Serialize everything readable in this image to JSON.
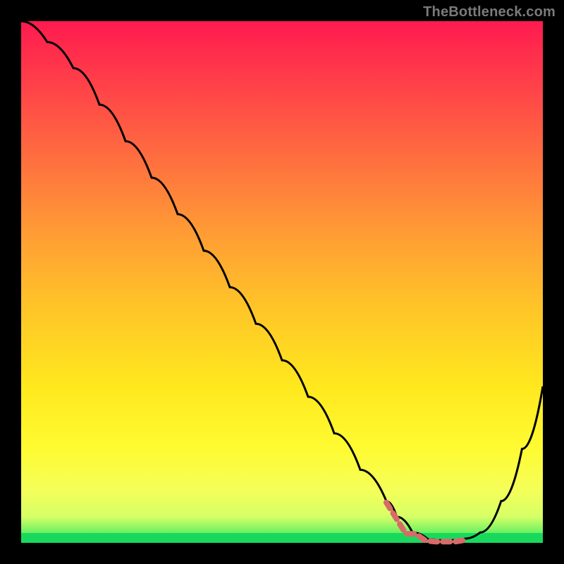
{
  "watermark": "TheBottleneck.com",
  "colors": {
    "background": "#000000",
    "gradient_top": "#ff1a4f",
    "gradient_bottom": "#28e860",
    "green_band": "#19d95c",
    "curve": "#000000",
    "marker": "#d86a6a"
  },
  "chart_data": {
    "type": "line",
    "title": "",
    "xlabel": "",
    "ylabel": "",
    "xlim": [
      0,
      100
    ],
    "ylim": [
      0,
      100
    ],
    "grid": false,
    "legend": false,
    "series": [
      {
        "name": "bottleneck-curve",
        "x": [
          0,
          5,
          10,
          15,
          20,
          25,
          30,
          35,
          40,
          45,
          50,
          55,
          60,
          65,
          70,
          72,
          75,
          78,
          80,
          82,
          85,
          88,
          92,
          96,
          100
        ],
        "y": [
          100,
          96,
          91,
          84,
          77,
          70,
          63,
          56,
          49,
          42,
          35,
          28,
          21,
          14,
          8,
          5,
          2,
          0.7,
          0.5,
          0.5,
          0.8,
          2,
          8,
          18,
          30
        ]
      }
    ],
    "optimal_range_x": [
      70,
      85
    ],
    "annotations": []
  }
}
